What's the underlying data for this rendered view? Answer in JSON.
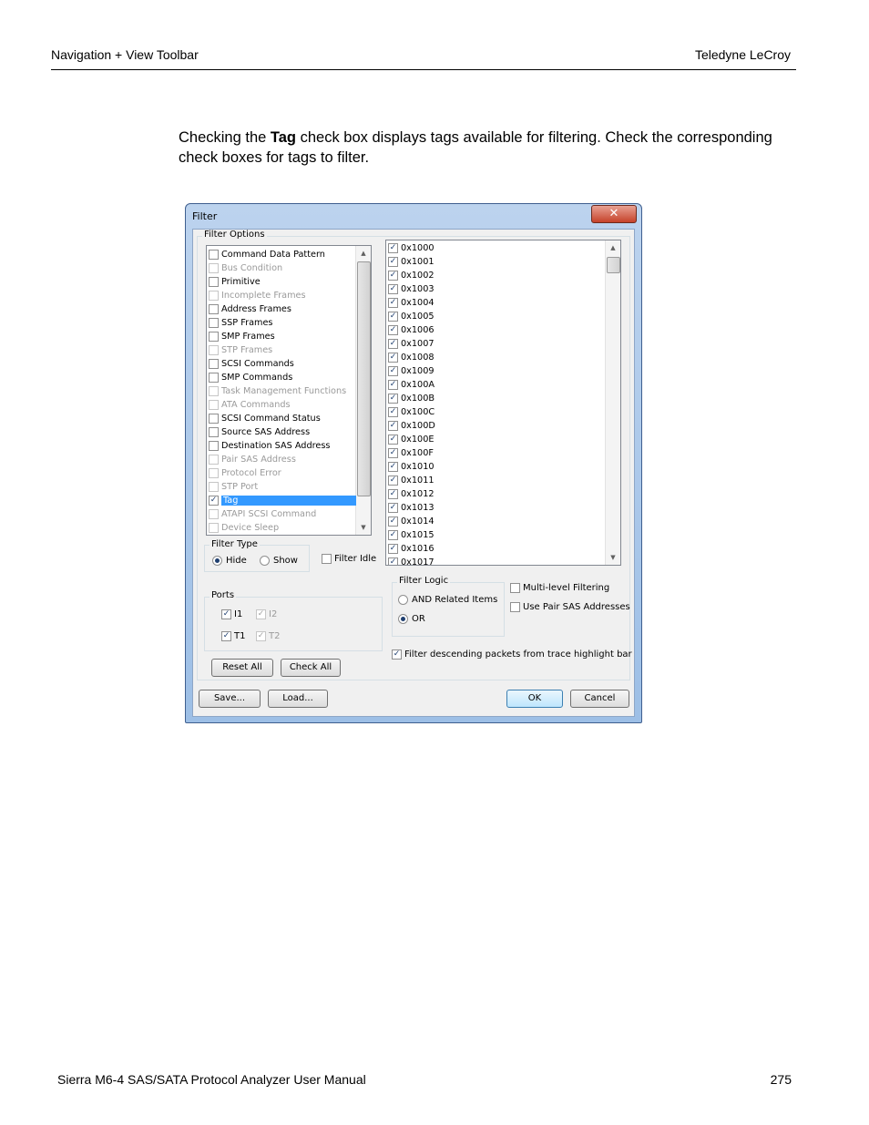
{
  "header": {
    "left": "Navigation + View Toolbar",
    "right": "Teledyne  LeCroy"
  },
  "paragraph": {
    "before": "Checking the ",
    "bold": "Tag",
    "after": " check box displays tags available for filtering. Check the corresponding check boxes for tags to filter."
  },
  "footer": {
    "left": "Sierra M6-4 SAS/SATA Protocol Analyzer User Manual",
    "right": "275"
  },
  "dialog": {
    "title": "Filter",
    "close_glyph": "✕",
    "filter_options_label": "Filter Options",
    "options": [
      {
        "label": "Command Data Pattern",
        "checked": false,
        "enabled": true
      },
      {
        "label": "Bus Condition",
        "checked": false,
        "enabled": false
      },
      {
        "label": "Primitive",
        "checked": false,
        "enabled": true
      },
      {
        "label": "Incomplete Frames",
        "checked": false,
        "enabled": false
      },
      {
        "label": "Address Frames",
        "checked": false,
        "enabled": true
      },
      {
        "label": "SSP Frames",
        "checked": false,
        "enabled": true
      },
      {
        "label": "SMP Frames",
        "checked": false,
        "enabled": true
      },
      {
        "label": "STP Frames",
        "checked": false,
        "enabled": false
      },
      {
        "label": "SCSI Commands",
        "checked": false,
        "enabled": true
      },
      {
        "label": "SMP Commands",
        "checked": false,
        "enabled": true
      },
      {
        "label": "Task Management Functions",
        "checked": false,
        "enabled": false
      },
      {
        "label": "ATA Commands",
        "checked": false,
        "enabled": false
      },
      {
        "label": "SCSI Command Status",
        "checked": false,
        "enabled": true
      },
      {
        "label": "Source SAS Address",
        "checked": false,
        "enabled": true
      },
      {
        "label": "Destination SAS Address",
        "checked": false,
        "enabled": true
      },
      {
        "label": "Pair SAS Address",
        "checked": false,
        "enabled": false
      },
      {
        "label": "Protocol Error",
        "checked": false,
        "enabled": false
      },
      {
        "label": "STP Port",
        "checked": false,
        "enabled": false
      },
      {
        "label": "Tag",
        "checked": true,
        "enabled": true,
        "selected": true
      },
      {
        "label": "ATAPI SCSI Command",
        "checked": false,
        "enabled": false
      },
      {
        "label": "Device Sleep",
        "checked": false,
        "enabled": false
      }
    ],
    "tags": [
      "0x1000",
      "0x1001",
      "0x1002",
      "0x1003",
      "0x1004",
      "0x1005",
      "0x1006",
      "0x1007",
      "0x1008",
      "0x1009",
      "0x100A",
      "0x100B",
      "0x100C",
      "0x100D",
      "0x100E",
      "0x100F",
      "0x1010",
      "0x1011",
      "0x1012",
      "0x1013",
      "0x1014",
      "0x1015",
      "0x1016",
      "0x1017"
    ],
    "filter_type": {
      "label": "Filter Type",
      "hide": "Hide",
      "show": "Show",
      "selected": "Hide"
    },
    "filter_idle": {
      "label": "Filter Idle",
      "checked": false
    },
    "ports": {
      "label": "Ports",
      "items": [
        {
          "label": "I1",
          "checked": true,
          "enabled": true
        },
        {
          "label": "I2",
          "checked": true,
          "enabled": false
        },
        {
          "label": "T1",
          "checked": true,
          "enabled": true
        },
        {
          "label": "T2",
          "checked": true,
          "enabled": false
        }
      ]
    },
    "filter_logic": {
      "label": "Filter Logic",
      "and": "AND Related Items",
      "or": "OR",
      "selected": "OR"
    },
    "multi_level": {
      "label": "Multi-level Filtering",
      "checked": false
    },
    "pair_sas": {
      "label": "Use Pair SAS Addresses",
      "checked": false
    },
    "descending": {
      "label": "Filter descending packets from trace highlight bar",
      "checked": true
    },
    "buttons": {
      "reset_all": "Reset All",
      "check_all": "Check All",
      "save": "Save...",
      "load": "Load...",
      "ok": "OK",
      "cancel": "Cancel"
    },
    "check_glyph": "✓"
  }
}
